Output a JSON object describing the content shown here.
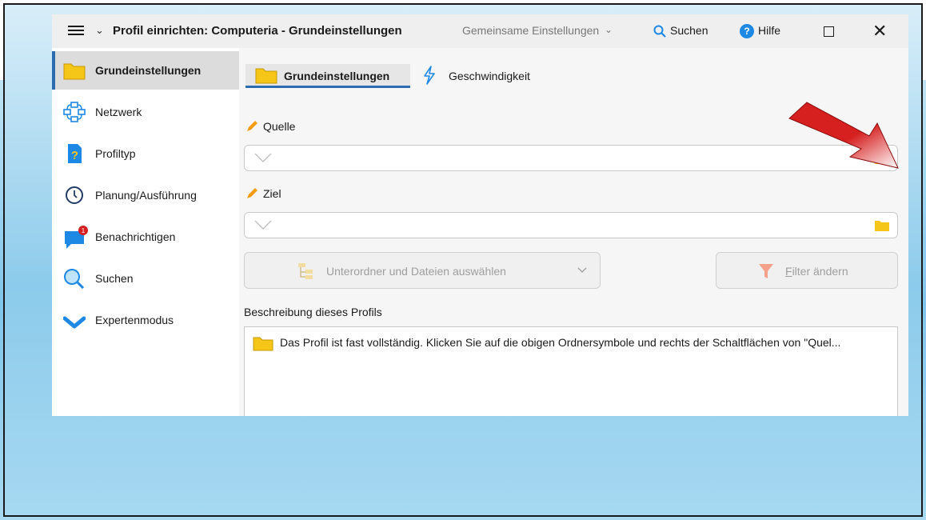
{
  "window": {
    "title": "Profil einrichten: Computeria - Grundeinstellungen",
    "shared_settings": "Gemeinsame Einstellungen",
    "search": "Suchen",
    "help": "Hilfe"
  },
  "sidebar": {
    "items": [
      {
        "label": "Grundeinstellungen",
        "icon": "folder-icon"
      },
      {
        "label": "Netzwerk",
        "icon": "network-icon"
      },
      {
        "label": "Profiltyp",
        "icon": "question-file-icon"
      },
      {
        "label": "Planung/Ausführung",
        "icon": "clock-icon"
      },
      {
        "label": "Benachrichtigen",
        "icon": "chat-bubble-icon",
        "badge": "1"
      },
      {
        "label": "Suchen",
        "icon": "magnifier-icon"
      },
      {
        "label": "Expertenmodus",
        "icon": "chevron-down-icon"
      }
    ]
  },
  "tabs": [
    {
      "label": "Grundeinstellungen",
      "icon": "folder-icon"
    },
    {
      "label": "Geschwindigkeit",
      "icon": "lightning-icon"
    }
  ],
  "source": {
    "label": "Quelle",
    "value": ""
  },
  "target": {
    "label": "Ziel",
    "value": ""
  },
  "buttons": {
    "subfolders": "Unterordner und Dateien auswählen",
    "filter_first": "F",
    "filter_rest": "ilter ändern"
  },
  "description": {
    "label": "Beschreibung dieses Profils",
    "text": "Das Profil ist fast vollständig. Klicken Sie auf die obigen Ordnersymbole und rechts der Schaltflächen von \"Quel..."
  },
  "colors": {
    "accent": "#2b6cb0",
    "folder": "#f5c518",
    "arrow": "#d61f1f"
  }
}
